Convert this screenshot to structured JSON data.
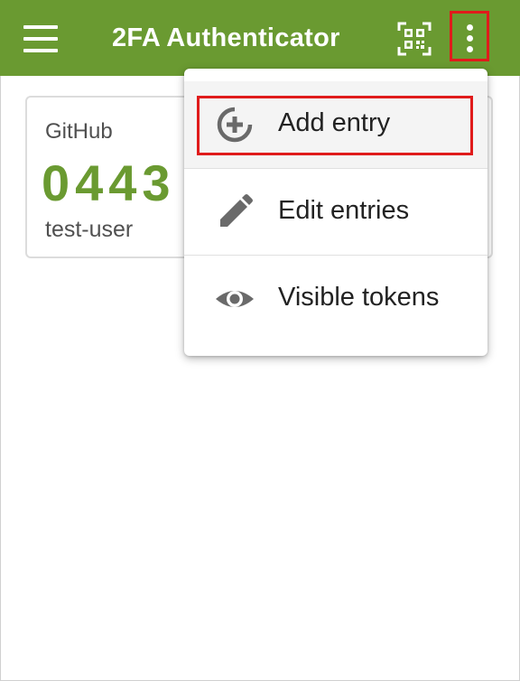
{
  "app": {
    "title": "2FA Authenticator"
  },
  "colors": {
    "accent": "#6a9a31",
    "highlight": "#e01b1b",
    "icon_gray": "#6a6a6a"
  },
  "topbar": {
    "menu_icon": "hamburger-menu-icon",
    "scan_icon": "qr-code-scan-icon",
    "more_icon": "more-vertical-icon"
  },
  "entries": [
    {
      "issuer": "GitHub",
      "code": "0443",
      "account": "test-user"
    }
  ],
  "dropdown": {
    "items": [
      {
        "label": "Add entry",
        "icon": "add-circle-icon"
      },
      {
        "label": "Edit entries",
        "icon": "pencil-icon"
      },
      {
        "label": "Visible tokens",
        "icon": "eye-icon"
      }
    ]
  }
}
